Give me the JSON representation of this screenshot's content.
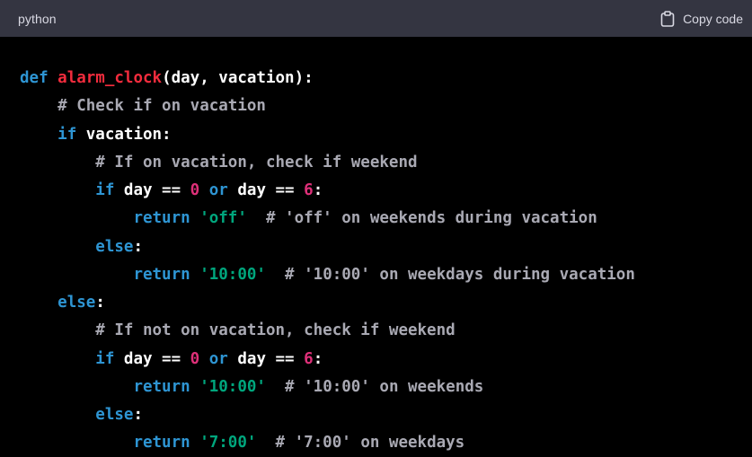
{
  "header": {
    "language": "python",
    "copy_label": "Copy code"
  },
  "code": {
    "lines": [
      [
        {
          "t": "def",
          "c": "kw"
        },
        {
          "t": " ",
          "c": ""
        },
        {
          "t": "alarm_clock",
          "c": "fn"
        },
        {
          "t": "(day, vacation):",
          "c": ""
        }
      ],
      [
        {
          "t": "    ",
          "c": ""
        },
        {
          "t": "# Check if on vacation",
          "c": "cm"
        }
      ],
      [
        {
          "t": "    ",
          "c": ""
        },
        {
          "t": "if",
          "c": "kw"
        },
        {
          "t": " vacation:",
          "c": ""
        }
      ],
      [
        {
          "t": "        ",
          "c": ""
        },
        {
          "t": "# If on vacation, check if weekend",
          "c": "cm"
        }
      ],
      [
        {
          "t": "        ",
          "c": ""
        },
        {
          "t": "if",
          "c": "kw"
        },
        {
          "t": " day == ",
          "c": ""
        },
        {
          "t": "0",
          "c": "num"
        },
        {
          "t": " ",
          "c": ""
        },
        {
          "t": "or",
          "c": "kw"
        },
        {
          "t": " day == ",
          "c": ""
        },
        {
          "t": "6",
          "c": "num"
        },
        {
          "t": ":",
          "c": ""
        }
      ],
      [
        {
          "t": "            ",
          "c": ""
        },
        {
          "t": "return",
          "c": "kw"
        },
        {
          "t": " ",
          "c": ""
        },
        {
          "t": "'off'",
          "c": "str"
        },
        {
          "t": "  ",
          "c": ""
        },
        {
          "t": "# 'off' on weekends during vacation",
          "c": "cm"
        }
      ],
      [
        {
          "t": "        ",
          "c": ""
        },
        {
          "t": "else",
          "c": "kw"
        },
        {
          "t": ":",
          "c": ""
        }
      ],
      [
        {
          "t": "            ",
          "c": ""
        },
        {
          "t": "return",
          "c": "kw"
        },
        {
          "t": " ",
          "c": ""
        },
        {
          "t": "'10:00'",
          "c": "str"
        },
        {
          "t": "  ",
          "c": ""
        },
        {
          "t": "# '10:00' on weekdays during vacation",
          "c": "cm"
        }
      ],
      [
        {
          "t": "    ",
          "c": ""
        },
        {
          "t": "else",
          "c": "kw"
        },
        {
          "t": ":",
          "c": ""
        }
      ],
      [
        {
          "t": "        ",
          "c": ""
        },
        {
          "t": "# If not on vacation, check if weekend",
          "c": "cm"
        }
      ],
      [
        {
          "t": "        ",
          "c": ""
        },
        {
          "t": "if",
          "c": "kw"
        },
        {
          "t": " day == ",
          "c": ""
        },
        {
          "t": "0",
          "c": "num"
        },
        {
          "t": " ",
          "c": ""
        },
        {
          "t": "or",
          "c": "kw"
        },
        {
          "t": " day == ",
          "c": ""
        },
        {
          "t": "6",
          "c": "num"
        },
        {
          "t": ":",
          "c": ""
        }
      ],
      [
        {
          "t": "            ",
          "c": ""
        },
        {
          "t": "return",
          "c": "kw"
        },
        {
          "t": " ",
          "c": ""
        },
        {
          "t": "'10:00'",
          "c": "str"
        },
        {
          "t": "  ",
          "c": ""
        },
        {
          "t": "# '10:00' on weekends",
          "c": "cm"
        }
      ],
      [
        {
          "t": "        ",
          "c": ""
        },
        {
          "t": "else",
          "c": "kw"
        },
        {
          "t": ":",
          "c": ""
        }
      ],
      [
        {
          "t": "            ",
          "c": ""
        },
        {
          "t": "return",
          "c": "kw"
        },
        {
          "t": " ",
          "c": ""
        },
        {
          "t": "'7:00'",
          "c": "str"
        },
        {
          "t": "  ",
          "c": ""
        },
        {
          "t": "# '7:00' on weekdays",
          "c": "cm"
        }
      ]
    ]
  },
  "colors": {
    "header_bg": "#343541",
    "code_bg": "#000000",
    "keyword": "#2e95d3",
    "function": "#f22c3d",
    "comment": "#a9a9b3",
    "number": "#df3079",
    "string": "#00a67d"
  },
  "icons": {
    "copy": "clipboard-icon"
  }
}
